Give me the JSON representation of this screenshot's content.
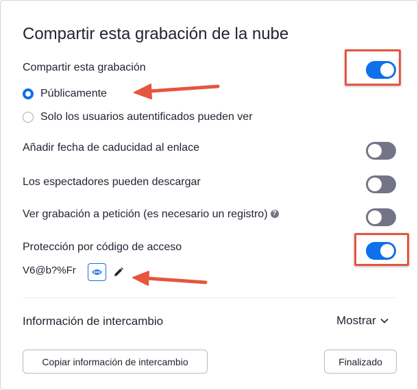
{
  "dialog": {
    "title": "Compartir esta grabación de la nube"
  },
  "share": {
    "label": "Compartir esta grabación",
    "enabled": true,
    "options": [
      {
        "label": "Públicamente",
        "selected": true
      },
      {
        "label": "Solo los usuarios autentificados pueden ver",
        "selected": false
      }
    ]
  },
  "settings": [
    {
      "label": "Añadir fecha de caducidad al enlace",
      "enabled": false
    },
    {
      "label": "Los espectadores pueden descargar",
      "enabled": false
    },
    {
      "label": "Ver grabación a petición (es necesario un registro)",
      "enabled": false,
      "help_icon": "question-circle-icon"
    },
    {
      "label": "Protección por código de acceso",
      "enabled": true
    }
  ],
  "passcode": {
    "value": "V6@b?%Fr",
    "show_icon": "eye-icon",
    "edit_icon": "pencil-icon"
  },
  "share_info": {
    "label": "Información de intercambio",
    "toggle_label": "Mostrar",
    "toggle_icon": "chevron-down-icon"
  },
  "buttons": {
    "copy": "Copiar información de intercambio",
    "done": "Finalizado"
  },
  "colors": {
    "accent": "#0e71eb",
    "toggle_off": "#747487",
    "annotation": "#e6553d"
  }
}
